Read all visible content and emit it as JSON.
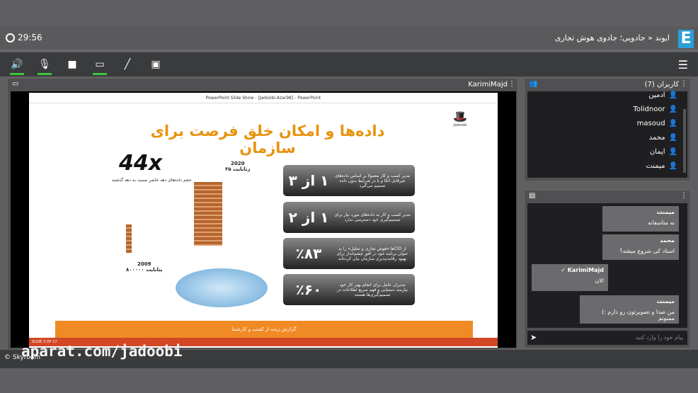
{
  "header": {
    "timer": "29:56",
    "title": "ایوند « جادویی؛ جادوی هوش تجاری",
    "logo": "E"
  },
  "toolbar": {
    "icons": [
      "speaker-icon",
      "microphone-icon",
      "camera-icon",
      "screen-share-icon",
      "brush-icon",
      "media-icon"
    ]
  },
  "video": {
    "presenter": "KarimiMajd",
    "ppt_title": "PowerPoint Slide Show - [Jadoobi-Azar98] - PowerPoint",
    "status": "SLIDE 3 OF 17"
  },
  "slide": {
    "title": "داده‌ها و امکان خلق فرصت برای سازمان",
    "logo": "Jadoobi",
    "big_number": "44x",
    "big_caption": "حجم داده‌های دهه حاضر نسبت به دهه گذشته",
    "year_top": "2020",
    "year_top_val": "۳۵ زتابایت",
    "year_bottom": "2009",
    "year_bottom_val": "۸۰۰۰۰۰ پتابایت",
    "cards": [
      {
        "num": "۱ از ۳",
        "text": "مدیر کسب و کار معمولا بر اساس داده‌های غیرقابل اتکا و یا در شرایط بدون داده تصمیم می‌گیرد"
      },
      {
        "num": "۱ از ۲",
        "text": "مدیر کسب و کار به داده‌های مورد نیاز برای تصمیم‌گیری خود دسترسی ندارد"
      },
      {
        "num": "٪۸۳",
        "text": "از CIOها «هوش تجاری و تحلیل» را به عنوان برنامه خود در افق چشم‌انداز برای بهبود رقابت‌پذیری سازمان بیان کرده‌اند"
      },
      {
        "num": "٪۶۰",
        "text": "مدیران عامل برای انجام بهتر کار خود نیازمند دستیابی و فهم سریع اطلاعات در تصمیم‌گیری‌ها هستند"
      }
    ],
    "footer": "گزارش زنده از کسب و کارشما"
  },
  "users": {
    "title": "کاربران (7)",
    "list": [
      "ادمین",
      "Tolidnoor",
      "masoud",
      "محمد",
      "ایمان",
      "میمنت"
    ]
  },
  "chat": {
    "messages": [
      {
        "author": "میمنت",
        "text": "نه متاسفانه"
      },
      {
        "author": "محمد",
        "text": "استاد کی شروع میشه؟"
      },
      {
        "author": "KarimiMajd",
        "text": "الان"
      },
      {
        "author": "میمنت",
        "text": "من صدا و تصویرتون رو دارم :) ممنونم"
      }
    ],
    "placeholder": "پیام خود را وارد کنید"
  },
  "watermark": "aparat.com/jadoobi",
  "footer": "© Skyroom"
}
